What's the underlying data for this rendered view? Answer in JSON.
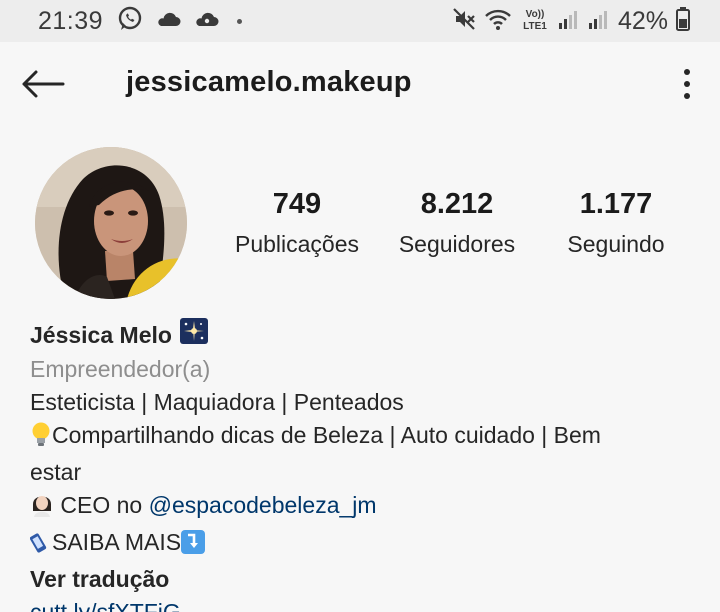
{
  "status_bar": {
    "time": "21:39",
    "battery": "42%",
    "network": "LTE1"
  },
  "header": {
    "username": "jessicamelo.makeup"
  },
  "profile": {
    "stats": [
      {
        "value": "749",
        "label": "Publicações"
      },
      {
        "value": "8.212",
        "label": "Seguidores"
      },
      {
        "value": "1.177",
        "label": "Seguindo"
      }
    ],
    "name": "Jéssica Melo",
    "category": "Empreendedor(a)",
    "bio_line1": "Esteticista | Maquiadora | Penteados",
    "bio_line2": "Compartilhando dicas de Beleza | Auto cuidado | Bem",
    "bio_line3": "estar",
    "ceo_prefix": "CEO no ",
    "ceo_mention": "@espacodebeleza_jm",
    "saiba_mais": "SAIBA MAIS",
    "translate": "Ver tradução",
    "link": "cutt.ly/sfXTFjG"
  },
  "colors": {
    "link": "#00376b",
    "category": "#8e8e8e",
    "status_bar_bg": "#ededed"
  }
}
